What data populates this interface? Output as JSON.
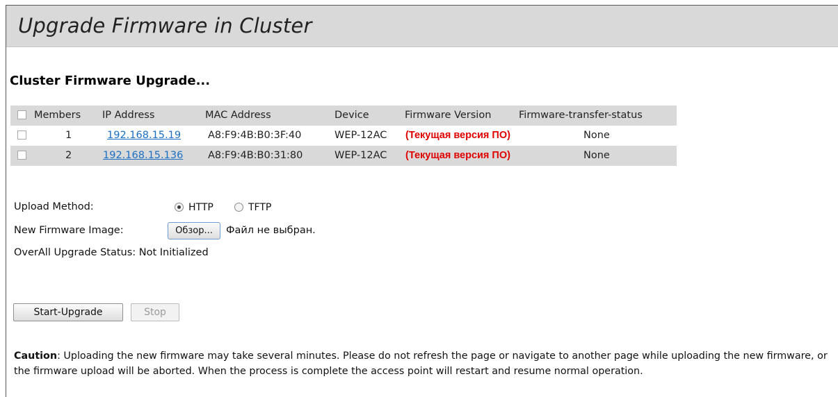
{
  "header": {
    "title": "Upgrade Firmware in Cluster"
  },
  "section": {
    "title": "Cluster Firmware Upgrade..."
  },
  "table": {
    "columns": [
      "Members",
      "IP Address",
      "MAC Address",
      "Device",
      "Firmware Version",
      "Firmware-transfer-status"
    ],
    "rows": [
      {
        "member": "1",
        "ip": "192.168.15.19",
        "mac": "A8:F9:4B:B0:3F:40",
        "device": "WEP-12AC",
        "firmware": "(Текущая версия ПО)",
        "status": "None"
      },
      {
        "member": "2",
        "ip": "192.168.15.136",
        "mac": "A8:F9:4B:B0:31:80",
        "device": "WEP-12AC",
        "firmware": "(Текущая версия ПО)",
        "status": "None"
      }
    ]
  },
  "form": {
    "upload_method_label": "Upload Method:",
    "http_label": "HTTP",
    "tftp_label": "TFTP",
    "selected_method": "HTTP",
    "image_label": "New Firmware Image:",
    "browse_label": "Обзор...",
    "file_status": "Файл не выбран.",
    "overall_status": "OverAll Upgrade Status: Not Initialized"
  },
  "buttons": {
    "start": "Start-Upgrade",
    "stop": "Stop"
  },
  "caution": {
    "label": "Caution",
    "text": ": Uploading the new firmware may take several minutes. Please do not refresh the page or navigate to another page while uploading the new firmware, or the firmware upload will be aborted. When the process is complete the access point will restart and resume normal operation."
  },
  "colors": {
    "header_bg": "#d9d9d9",
    "link": "#1a6fc4",
    "firmware_text": "#e00000"
  }
}
